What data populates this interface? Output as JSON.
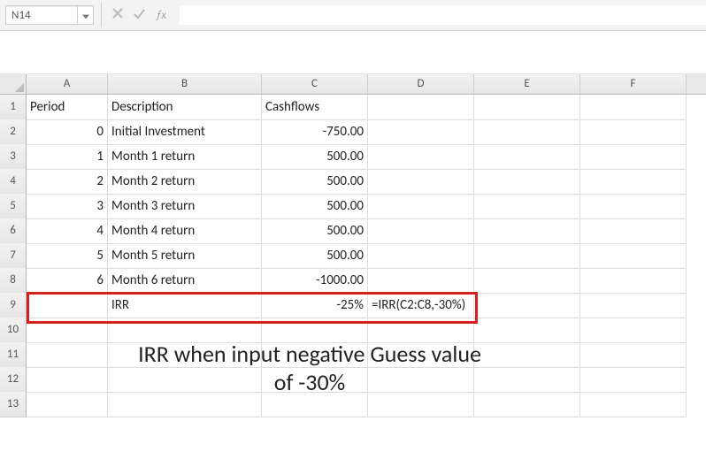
{
  "formula_bar": {
    "cell_ref": "N14",
    "formula": ""
  },
  "columns": [
    "A",
    "B",
    "C",
    "D",
    "E",
    "F"
  ],
  "row_numbers": [
    "1",
    "2",
    "3",
    "4",
    "5",
    "6",
    "7",
    "8",
    "9",
    "10",
    "11",
    "12",
    "13"
  ],
  "hdr": {
    "A": "Period",
    "B": "Description",
    "C": "Cashflows"
  },
  "rows": [
    {
      "A": "0",
      "B": "Initial Investment",
      "C": "-750.00"
    },
    {
      "A": "1",
      "B": "Month 1 return",
      "C": "500.00"
    },
    {
      "A": "2",
      "B": "Month 2 return",
      "C": "500.00"
    },
    {
      "A": "3",
      "B": "Month 3 return",
      "C": "500.00"
    },
    {
      "A": "4",
      "B": "Month 4 return",
      "C": "500.00"
    },
    {
      "A": "5",
      "B": "Month 5 return",
      "C": "500.00"
    },
    {
      "A": "6",
      "B": "Month 6 return",
      "C": "-1000.00"
    }
  ],
  "irr": {
    "label": "IRR",
    "value": "-25%",
    "formula": "=IRR(C2:C8,-30%)"
  },
  "caption_line1": "IRR when input negative Guess value",
  "caption_line2": "of -30%",
  "highlight": {
    "row": 9,
    "from_col": "A",
    "to_col": "D"
  }
}
